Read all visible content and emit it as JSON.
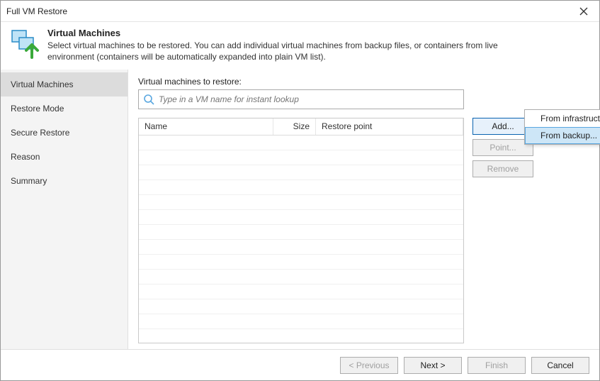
{
  "window": {
    "title": "Full VM Restore"
  },
  "header": {
    "title": "Virtual Machines",
    "desc": "Select virtual machines to be restored. You can add individual virtual machines from backup files, or containers from live environment (containers will be automatically expanded into plain VM list)."
  },
  "sidebar": {
    "items": [
      {
        "label": "Virtual Machines",
        "active": true
      },
      {
        "label": "Restore Mode"
      },
      {
        "label": "Secure Restore"
      },
      {
        "label": "Reason"
      },
      {
        "label": "Summary"
      }
    ]
  },
  "main": {
    "list_label": "Virtual machines to restore:",
    "search_placeholder": "Type in a VM name for instant lookup",
    "columns": {
      "name": "Name",
      "size": "Size",
      "restore_point": "Restore point"
    }
  },
  "buttons": {
    "add": "Add...",
    "point": "Point...",
    "remove": "Remove"
  },
  "dropdown": {
    "infra": "From infrastructure...",
    "backup": "From backup..."
  },
  "footer": {
    "previous": "< Previous",
    "next": "Next >",
    "finish": "Finish",
    "cancel": "Cancel"
  }
}
